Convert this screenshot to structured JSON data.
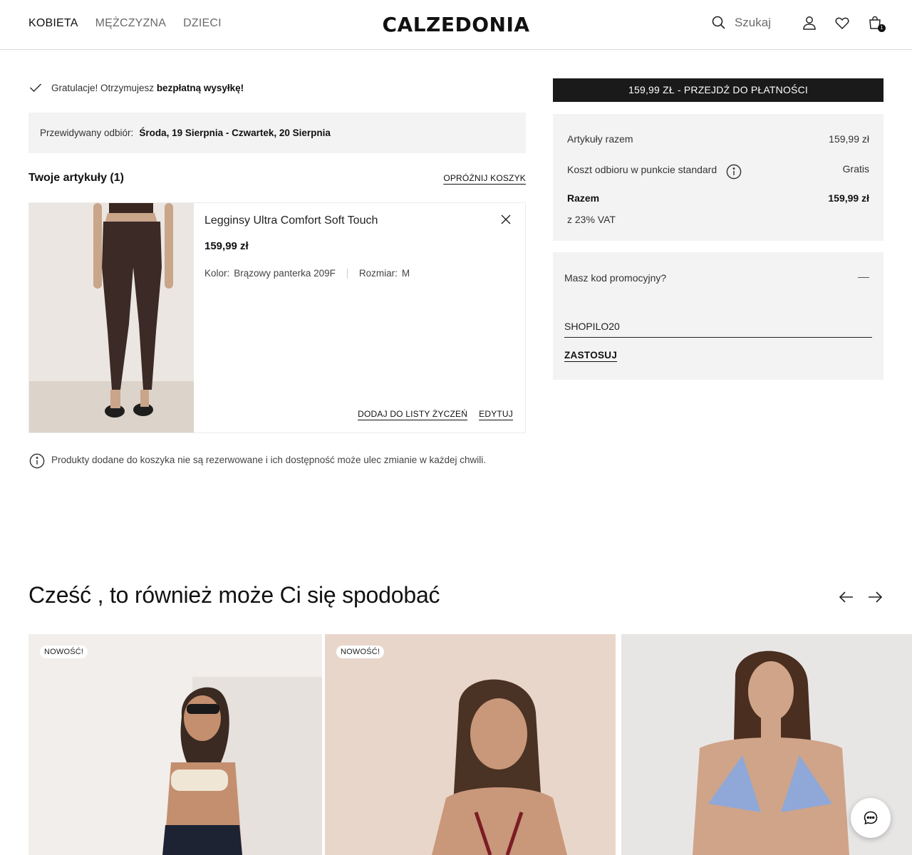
{
  "header": {
    "nav": [
      "KOBIETA",
      "MĘŻCZYZNA",
      "DZIECI"
    ],
    "logo": "CALZEDONIA",
    "search_placeholder": "Szukaj",
    "bag_count": "1"
  },
  "cart": {
    "congrats_text": "Gratulacje! Otrzymujesz",
    "congrats_bold": "bezpłatną wysyłkę!",
    "pickup_label": "Przewidywany odbiór:",
    "pickup_dates": "Środa, 19 Sierpnia - Czwartek, 20 Sierpnia",
    "items_title": "Twoje artykuły (1)",
    "empty_cart": "OPRÓŻNIJ KOSZYK",
    "item": {
      "name": "Legginsy Ultra Comfort Soft Touch",
      "price": "159,99 zł",
      "color_label": "Kolor:",
      "color_value": "Brązowy panterka 209F",
      "size_label": "Rozmiar:",
      "size_value": "M",
      "wishlist": "DODAJ DO LISTY ŻYCZEŃ",
      "edit": "EDYTUJ"
    },
    "disclaimer": "Produkty dodane do koszyka nie są rezerwowane i ich dostępność może ulec zmianie w każdej chwili."
  },
  "summary": {
    "checkout_button": "159,99 ZŁ - PRZEJDŹ DO PŁATNOŚCI",
    "items_label": "Artykuły razem",
    "items_value": "159,99 zł",
    "shipping_label": "Koszt odbioru w punkcie standard",
    "shipping_value": "Gratis",
    "total_label": "Razem",
    "total_value": "159,99 zł",
    "vat": "z 23% VAT"
  },
  "promo": {
    "title": "Masz kod promocyjny?",
    "code_value": "SHOPILO20",
    "apply": "ZASTOSUJ"
  },
  "recommendations": {
    "title": "Cześć , to również może Ci się spodobać",
    "badges": [
      "NOWOŚĆ!",
      "NOWOŚĆ!"
    ]
  },
  "colors": {
    "primary_dark": "#1a1a1a",
    "panel_bg": "#f3f3f3"
  }
}
